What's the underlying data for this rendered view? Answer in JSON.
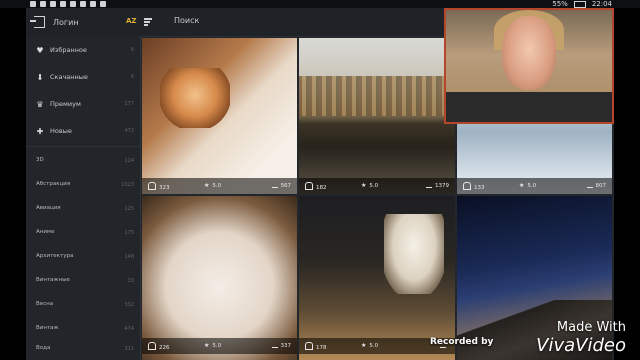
{
  "statusbar": {
    "time": "22:04",
    "battery": "55%"
  },
  "toolbar": {
    "logout_label": "Логин",
    "sort_label": "AZ",
    "search_label": "Поиск"
  },
  "sidebar": {
    "main": [
      {
        "label": "Избранное",
        "count": "6",
        "icon": "heart-icon"
      },
      {
        "label": "Скачанные",
        "count": "6",
        "icon": "download-icon"
      },
      {
        "label": "Премиум",
        "count": "177",
        "icon": "crown-icon"
      },
      {
        "label": "Новые",
        "count": "472",
        "icon": "new-icon"
      }
    ],
    "categories": [
      {
        "label": "3D",
        "count": "124"
      },
      {
        "label": "Абстракция",
        "count": "1023"
      },
      {
        "label": "Авиация",
        "count": "125"
      },
      {
        "label": "Аниме",
        "count": "175"
      },
      {
        "label": "Архитектура",
        "count": "148"
      },
      {
        "label": "Винтажные",
        "count": "33"
      },
      {
        "label": "Весна",
        "count": "332"
      },
      {
        "label": "Винтаж",
        "count": "474"
      },
      {
        "label": "Вода",
        "count": "311"
      }
    ]
  },
  "tiles": [
    {
      "likes": "323",
      "rating": "5.0",
      "downloads": "567"
    },
    {
      "likes": "182",
      "rating": "5.0",
      "downloads": "1379"
    },
    {
      "likes": "133",
      "rating": "5.0",
      "downloads": "807"
    },
    {
      "likes": "226",
      "rating": "5.0",
      "downloads": "337"
    },
    {
      "likes": "178",
      "rating": "5.0",
      "downloads": ""
    },
    {
      "likes": "",
      "rating": "",
      "downloads": ""
    }
  ],
  "watermark": {
    "recorded": "Recorded by ",
    "made_with": "Made With",
    "viva": "VivaVideo"
  }
}
